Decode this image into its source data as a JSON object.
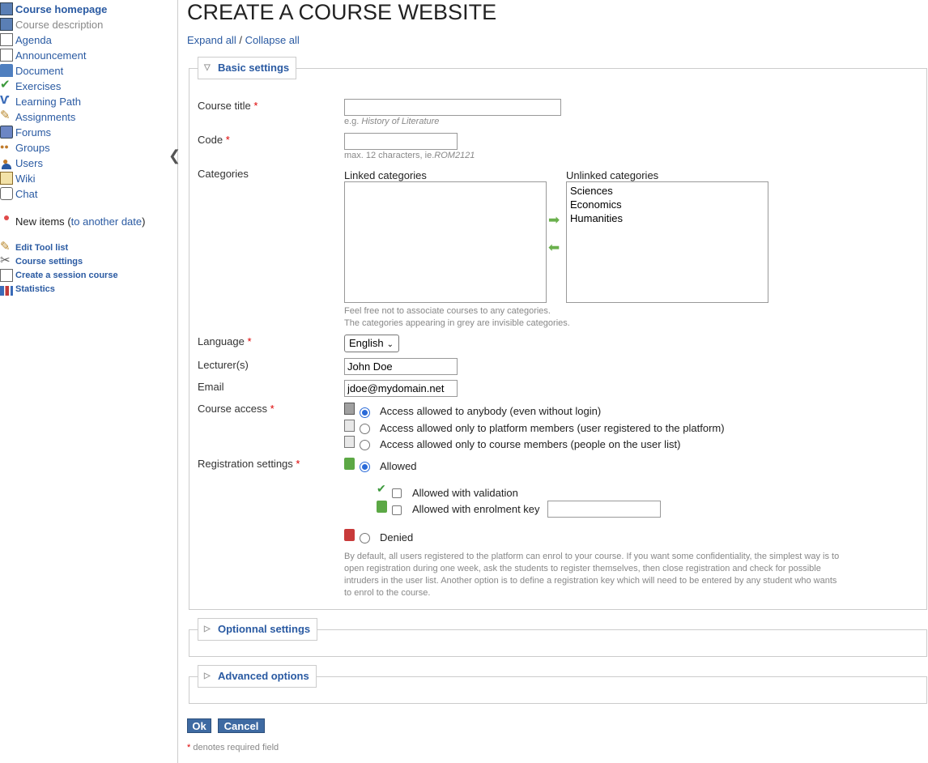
{
  "sidebar": {
    "tools": [
      {
        "label": "Course homepage",
        "icon": "course-home-icon"
      },
      {
        "label": "Course description",
        "icon": "description-icon"
      },
      {
        "label": "Agenda",
        "icon": "agenda-icon"
      },
      {
        "label": "Announcement",
        "icon": "announcement-icon"
      },
      {
        "label": "Document",
        "icon": "folder-icon"
      },
      {
        "label": "Exercises",
        "icon": "check-icon"
      },
      {
        "label": "Learning Path",
        "icon": "learning-path-icon"
      },
      {
        "label": "Assignments",
        "icon": "pencil-icon"
      },
      {
        "label": "Forums",
        "icon": "forum-icon"
      },
      {
        "label": "Groups",
        "icon": "groups-icon"
      },
      {
        "label": "Users",
        "icon": "user-icon"
      },
      {
        "label": "Wiki",
        "icon": "wiki-icon"
      },
      {
        "label": "Chat",
        "icon": "chat-icon"
      }
    ],
    "new_items_label": "New items",
    "new_items_paren_open": "(",
    "new_items_link": "to another date",
    "new_items_paren_close": ")",
    "admin": [
      {
        "label": "Edit Tool list",
        "icon": "edit-pencil-icon"
      },
      {
        "label": "Course settings",
        "icon": "settings-tools-icon"
      },
      {
        "label": "Create a session course",
        "icon": "session-icon"
      },
      {
        "label": "Statistics",
        "icon": "statistics-icon"
      }
    ]
  },
  "page": {
    "title": "CREATE A COURSE WEBSITE",
    "expand_all": "Expand all",
    "separator": "/",
    "collapse_all": "Collapse all"
  },
  "basic": {
    "legend": "Basic settings",
    "course_title_label": "Course title",
    "course_title_value": "",
    "course_title_hint_prefix": "e.g.",
    "course_title_hint_example": "History of Literature",
    "code_label": "Code",
    "code_value": "",
    "code_hint_prefix": "max. 12 characters, ie.",
    "code_hint_example": "ROM2121",
    "categories_label": "Categories",
    "linked_label": "Linked categories",
    "unlinked_label": "Unlinked categories",
    "linked": [],
    "unlinked": [
      "Sciences",
      "Economics",
      "Humanities"
    ],
    "categories_hint1": "Feel free not to associate courses to any categories.",
    "categories_hint2": "The categories appearing in grey are invisible categories.",
    "language_label": "Language",
    "language_value": "English",
    "lecturer_label": "Lecturer(s)",
    "lecturer_value": "John Doe",
    "email_label": "Email",
    "email_value": "jdoe@mydomain.net",
    "access_label": "Course access",
    "access_options": [
      "Access allowed to anybody (even without login)",
      "Access allowed only to platform members (user registered to the platform)",
      "Access allowed only to course members (people on the user list)"
    ],
    "registration_label": "Registration settings",
    "reg_allowed": "Allowed",
    "reg_validation": "Allowed with validation",
    "reg_key": "Allowed with enrolment key",
    "reg_key_value": "",
    "reg_denied": "Denied",
    "reg_description": "By default, all users registered to the platform can enrol to your course. If you want some confidentiality, the simplest way is to open registration during one week, ask the students to register themselves, then close registration and check for possible intruders in the user list. Another option is to define a registration key which will need to be entered by any student who wants to enrol to the course.",
    "required_mark": "*"
  },
  "optional": {
    "legend": "Optionnal settings"
  },
  "advanced": {
    "legend": "Advanced options"
  },
  "actions": {
    "ok": "Ok",
    "cancel": "Cancel"
  },
  "footer": {
    "required_mark": "*",
    "required_note": "denotes required field"
  },
  "colors": {
    "link": "#2a5aa2",
    "button": "#3e6aa2",
    "required": "#dd0000"
  }
}
